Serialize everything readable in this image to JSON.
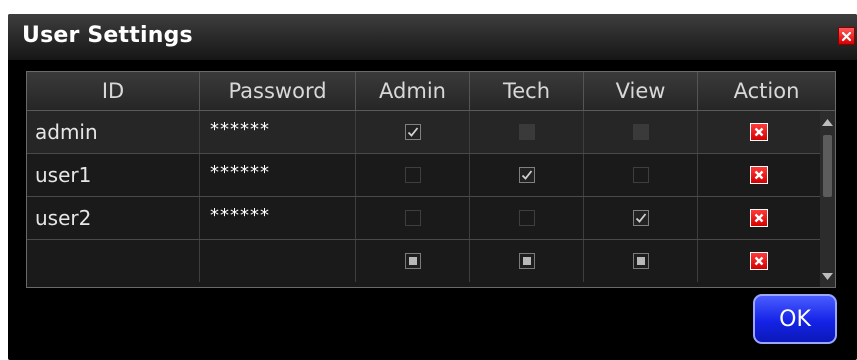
{
  "dialog": {
    "title": "User Settings",
    "close_icon": "close-icon"
  },
  "table": {
    "columns": [
      "ID",
      "Password",
      "Admin",
      "Tech",
      "View",
      "Action"
    ],
    "rows": [
      {
        "id": "admin",
        "password": "******",
        "admin": "checked",
        "tech": "filled",
        "view": "filled"
      },
      {
        "id": "user1",
        "password": "******",
        "admin": "empty",
        "tech": "checked",
        "view": "empty"
      },
      {
        "id": "user2",
        "password": "******",
        "admin": "empty",
        "tech": "empty",
        "view": "checked"
      },
      {
        "id": "",
        "password": "",
        "admin": "indeterminate",
        "tech": "indeterminate",
        "view": "indeterminate"
      }
    ],
    "action_icon": "delete-icon"
  },
  "buttons": {
    "ok_label": "OK"
  },
  "colors": {
    "background": "#000000",
    "delete": "#e00000",
    "ok": "#1a2ae8"
  }
}
